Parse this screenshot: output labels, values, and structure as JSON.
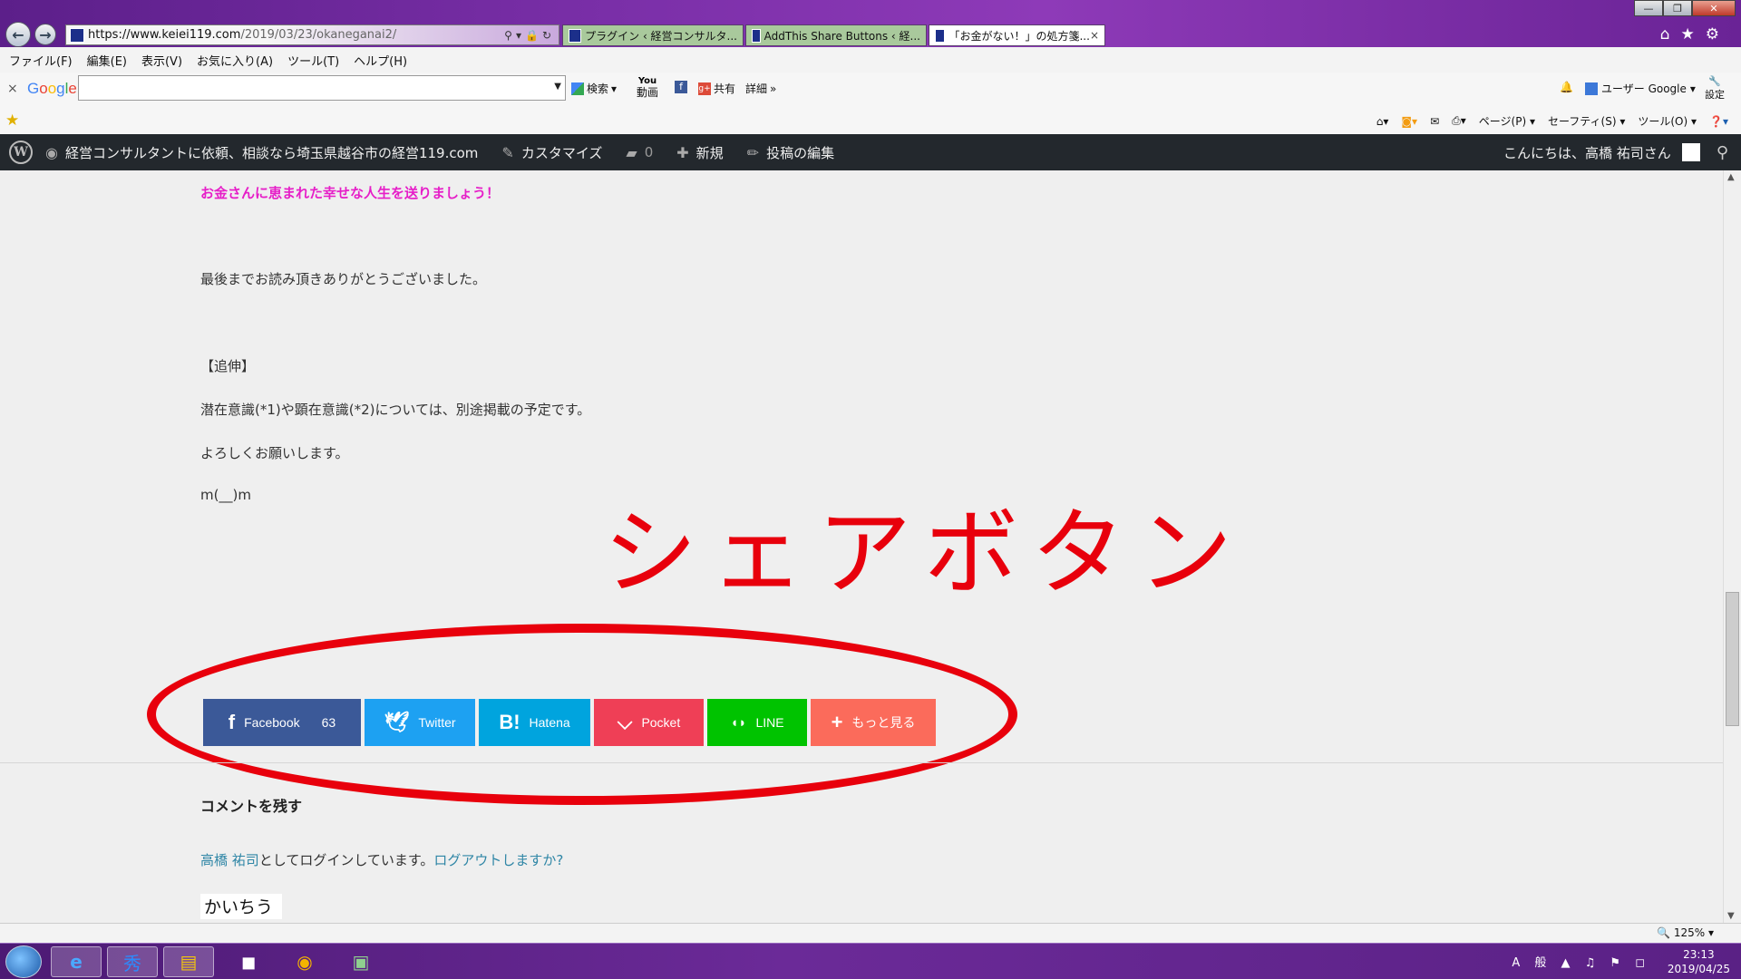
{
  "browser": {
    "url_host": "https://www.keiei119.com",
    "url_path": "/2019/03/23/okaneganai2/",
    "tabs": [
      {
        "label": "プラグイン ‹ 経営コンサルタ..."
      },
      {
        "label": "AddThis Share Buttons ‹ 経..."
      },
      {
        "label": "「お金がない！」の処方箋..."
      }
    ],
    "menu": [
      "ファイル(F)",
      "編集(E)",
      "表示(V)",
      "お気に入り(A)",
      "ツール(T)",
      "ヘルプ(H)"
    ],
    "google_toolbar": {
      "logo": "Google",
      "search_label": "検索",
      "video_label_top": "You",
      "video_label": "動画",
      "share_label": "共有",
      "detail_label": "詳細",
      "user_label": "ユーザー Google",
      "settings_label": "設定"
    },
    "command_bar": {
      "page": "ページ(P)",
      "safety": "セーフティ(S)",
      "tools": "ツール(O)"
    },
    "zoom": "125%"
  },
  "wp_admin": {
    "site_name": "経営コンサルタントに依頼、相談なら埼玉県越谷市の経営119.com",
    "customize": "カスタマイズ",
    "comments_count": "0",
    "new": "新規",
    "edit_post": "投稿の編集",
    "greeting": "こんにちは、高橋 祐司さん"
  },
  "content": {
    "pink_line": "お金さんに恵まれた幸せな人生を送りましょう！",
    "thanks": "最後までお読み頂きありがとうございました。",
    "postscript": "【追伸】",
    "note": "潜在意識(*1)や顕在意識(*2)については、別途掲載の予定です。",
    "regards": "よろしくお願いします。",
    "bow": "m(__)m",
    "annotation": "シェアボタン",
    "comment_title": "コメントを残す",
    "login_user": "高橋 祐司",
    "login_mid": "としてログインしています。",
    "logout": "ログアウトしますか?",
    "captcha_text": "かいちう"
  },
  "share_buttons": {
    "facebook": "Facebook",
    "facebook_count": "63",
    "twitter": "Twitter",
    "hatena": "Hatena",
    "pocket": "Pocket",
    "line": "LINE",
    "more": "もっと見る"
  },
  "taskbar": {
    "time": "23:13",
    "date": "2019/04/25"
  },
  "colors": {
    "annotation_red": "#e8000c",
    "facebook": "#3b5998",
    "twitter": "#1da1f2",
    "hatena": "#00a4de",
    "pocket": "#ef3f56",
    "line": "#00c300",
    "more": "#fb6b5b",
    "pink_text": "#e61ec8"
  }
}
